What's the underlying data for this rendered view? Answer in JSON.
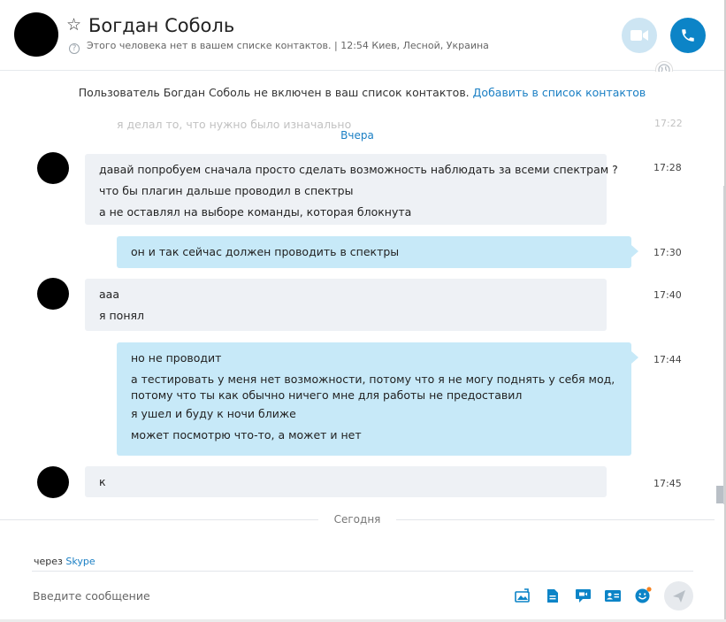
{
  "header": {
    "contact_name": "Богдан Соболь",
    "status_text": "Этого человека нет в вашем списке контактов.  |  12:54 Киев, Лесной, Украина",
    "info_glyph": "?"
  },
  "notice": {
    "text": "Пользователь Богдан Соболь не включен в ваш список контактов.",
    "link": "Добавить в список контактов"
  },
  "history": {
    "faded_text": "я делал то, что нужно было изначально",
    "faded_time": "17:22",
    "day_label": "Вчера"
  },
  "messages": [
    {
      "direction": "in",
      "time": "17:28",
      "lines": [
        "давай попробуем сначала просто сделать возможность наблюдать за всеми спектрам ?",
        "что бы плагин дальше проводил в спектры",
        "а не оставлял на выборе команды, которая блокнута"
      ]
    },
    {
      "direction": "out",
      "time": "17:30",
      "lines": [
        "он и так сейчас должен проводить в спектры"
      ]
    },
    {
      "direction": "in",
      "time": "17:40",
      "lines": [
        "ааа",
        "я понял"
      ]
    },
    {
      "direction": "out",
      "time": "17:44",
      "lines": [
        "но не проводит",
        "а тестировать у меня нет возможности, потому что я не могу поднять у себя мод,",
        "потому что ты как обычно ничего мне для работы не предоставил",
        "я ушел и буду к ночи ближе",
        "может посмотрю что-то, а может и нет"
      ]
    },
    {
      "direction": "in",
      "time": "17:45",
      "lines": [
        "к"
      ]
    }
  ],
  "today_label": "Сегодня",
  "compose": {
    "via_prefix": "через",
    "via_service": "Skype",
    "placeholder": "Введите сообщение"
  },
  "colors": {
    "accent": "#0c84c7",
    "link": "#1a7fc4",
    "incoming_bubble": "#eef1f5",
    "outgoing_bubble": "#c7e9f8"
  }
}
